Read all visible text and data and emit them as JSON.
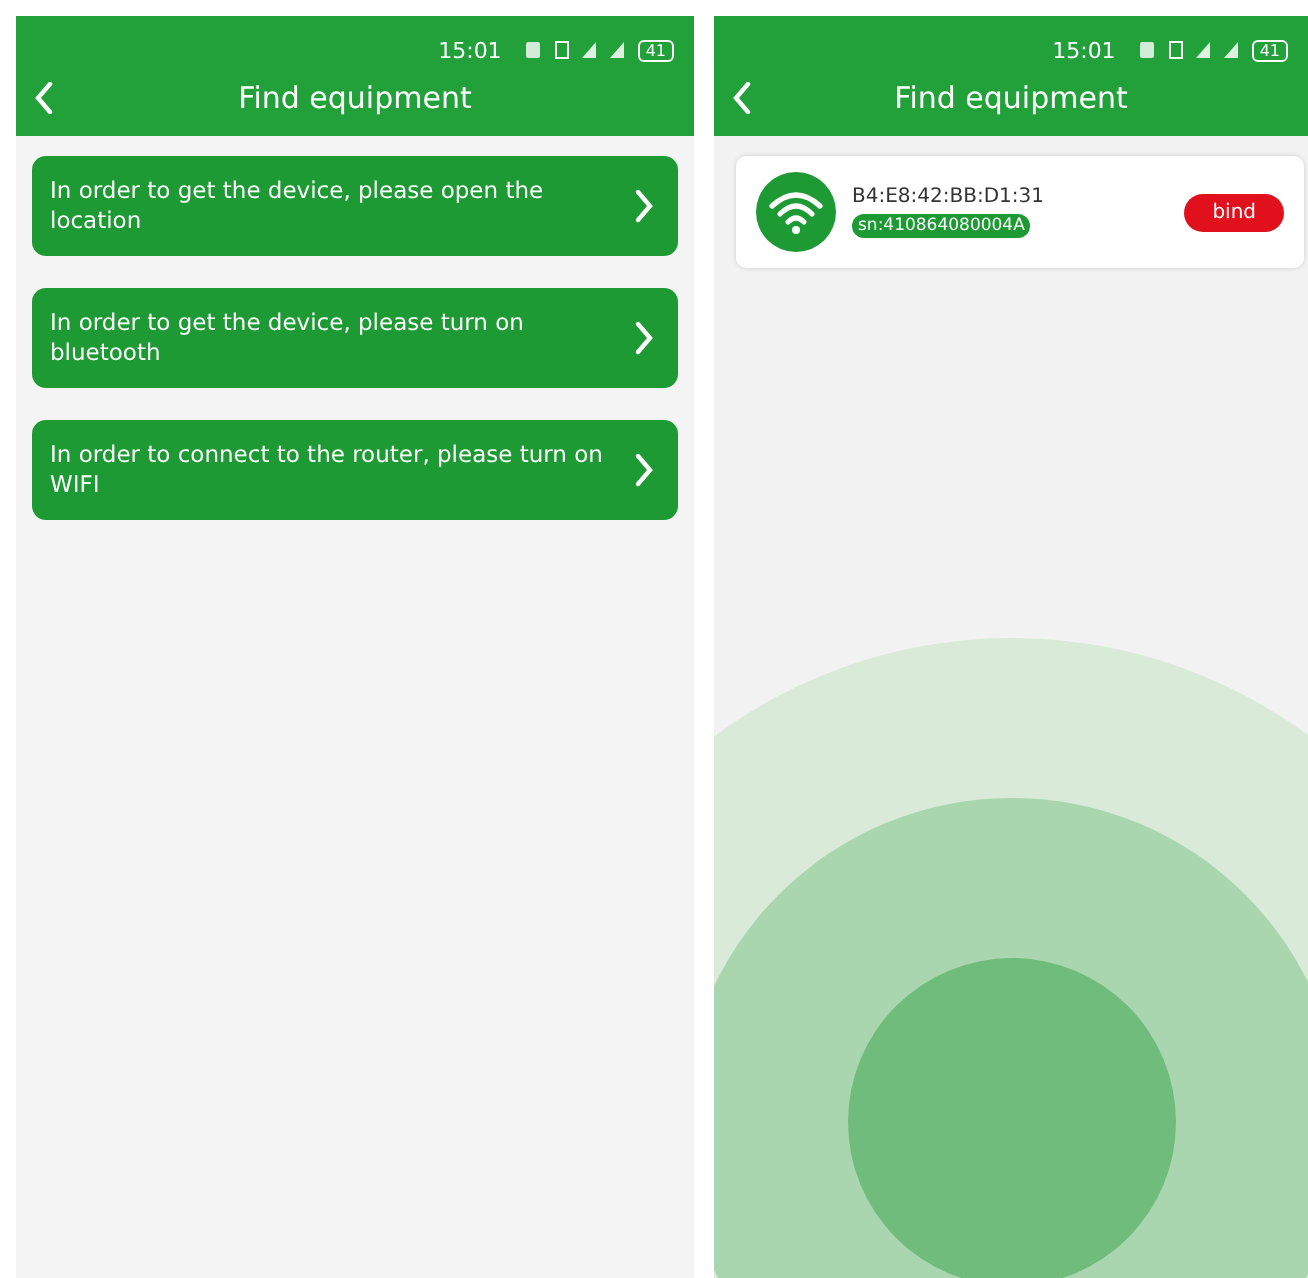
{
  "screens": [
    {
      "status_bar": {
        "time": "15:01",
        "battery": "41"
      },
      "title": "Find equipment",
      "prompts": [
        {
          "text": "In order to get the device, please open the location"
        },
        {
          "text": "In order to get the device, please turn on bluetooth"
        },
        {
          "text": "In order to connect to the router, please turn on WIFI"
        }
      ]
    },
    {
      "status_bar": {
        "time": "15:01",
        "battery": "41"
      },
      "title": "Find equipment",
      "devices": [
        {
          "mac": "B4:E8:42:BB:D1:31",
          "serial": "sn:410864080004A",
          "action": "bind"
        }
      ],
      "radar": true
    }
  ]
}
